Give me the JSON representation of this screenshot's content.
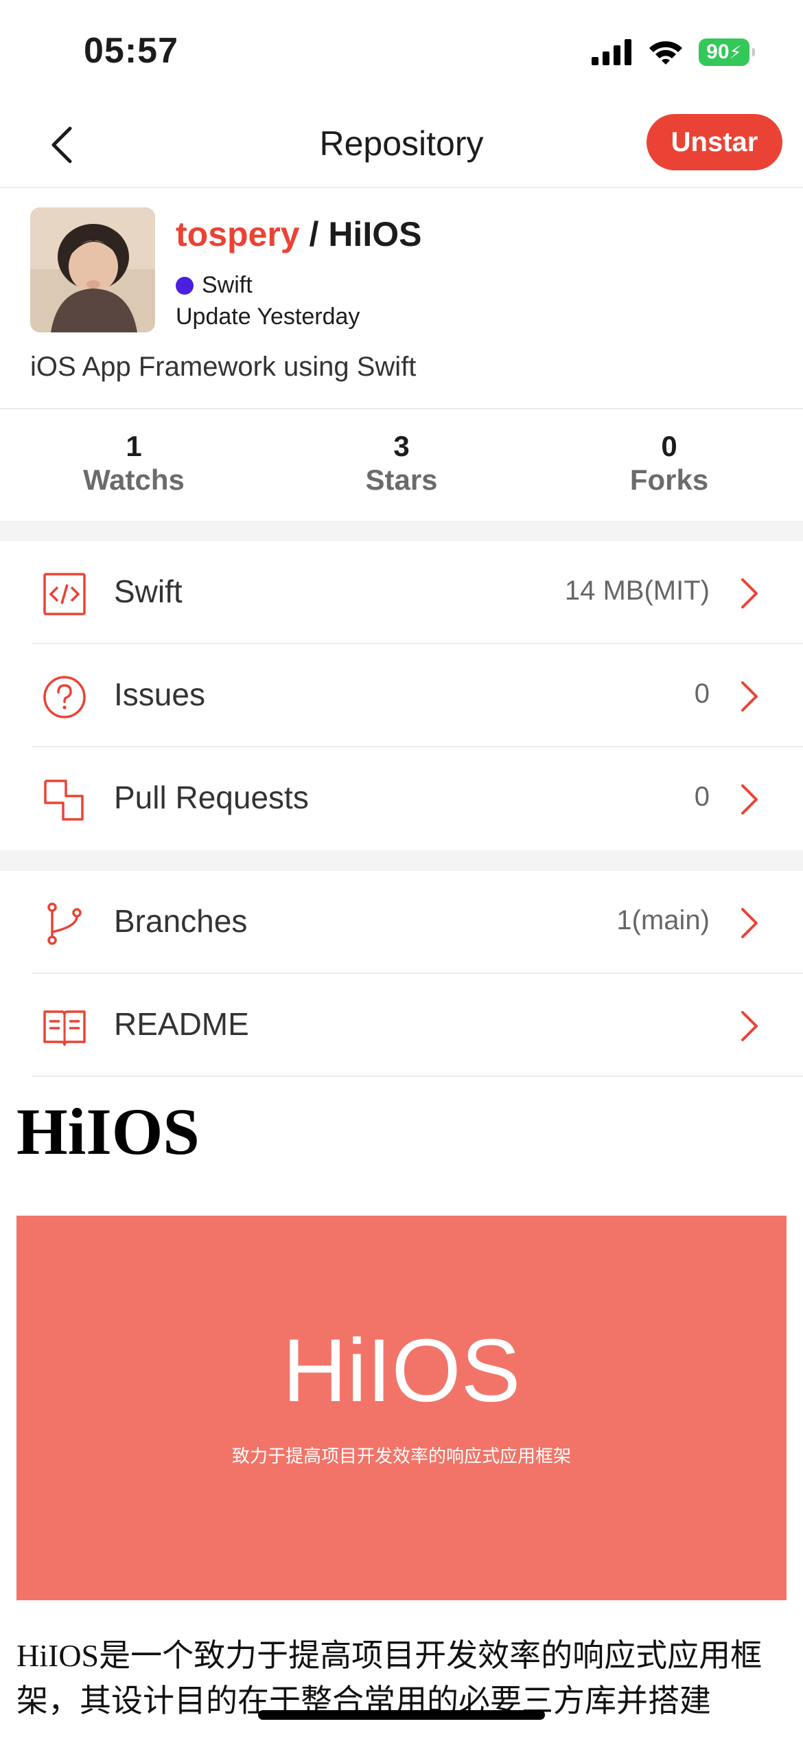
{
  "status_bar": {
    "time": "05:57",
    "battery": "90"
  },
  "nav": {
    "title": "Repository",
    "unstar_label": "Unstar"
  },
  "repo": {
    "owner": "tospery",
    "separator": " / ",
    "name": "HiIOS",
    "language": "Swift",
    "language_color": "#4a1fe0",
    "updated": "Update Yesterday",
    "description": "iOS App Framework using Swift"
  },
  "stats": [
    {
      "count": "1",
      "label": "Watchs"
    },
    {
      "count": "3",
      "label": "Stars"
    },
    {
      "count": "0",
      "label": "Forks"
    }
  ],
  "rows": [
    {
      "label": "Swift",
      "value": "14 MB(MIT)",
      "icon": "code-icon"
    },
    {
      "label": "Issues",
      "value": "0",
      "icon": "question-circle-icon"
    },
    {
      "label": "Pull Requests",
      "value": "0",
      "icon": "pull-request-icon"
    },
    {
      "label": "Branches",
      "value": "1(main)",
      "icon": "branch-icon"
    },
    {
      "label": "README",
      "value": "",
      "icon": "book-icon"
    }
  ],
  "readme": {
    "title": "HiIOS",
    "banner_title": "HiIOS",
    "banner_subtitle": "致力于提高项目开发效率的响应式应用框架",
    "body": "HiIOS是一个致力于提高项目开发效率的响应式应用框架，其设计目的在于整合常用的必要三方库并搭建"
  },
  "colors": {
    "accent": "#ea4335",
    "banner": "#f27468",
    "battery": "#34c759"
  }
}
